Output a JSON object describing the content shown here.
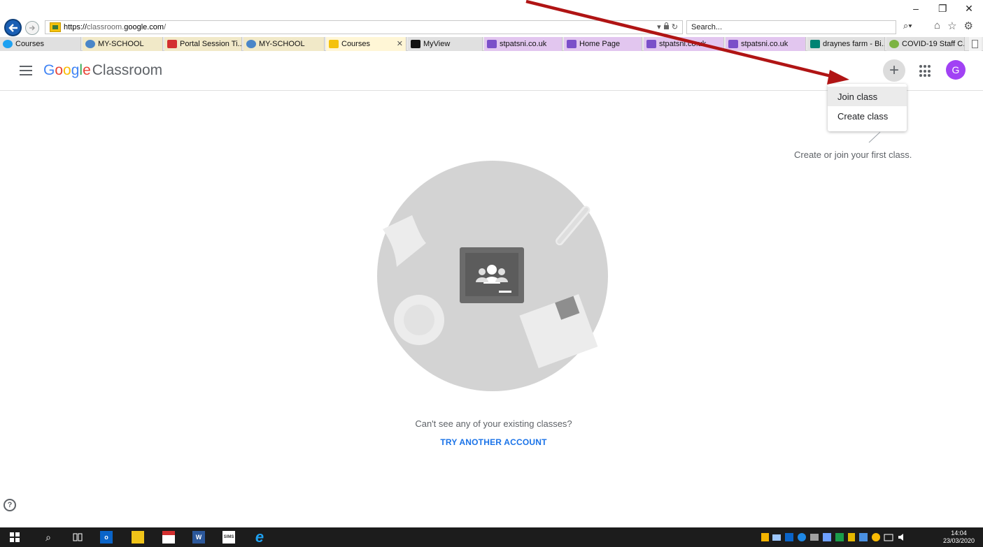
{
  "browser": {
    "url_scheme": "https://",
    "url_prefix": "classroom.",
    "url_host": "google.com",
    "url_suffix": "/",
    "search_placeholder": "Search...",
    "window_controls": [
      "–",
      "❐",
      "✕"
    ],
    "tabs": [
      {
        "label": "Courses",
        "icon": "ie-icon",
        "color": "#e0e0e0"
      },
      {
        "label": "MY-SCHOOL",
        "icon": "myschool-icon",
        "color": "#f1e9c8"
      },
      {
        "label": "Portal Session Ti...",
        "icon": "n-icon",
        "color": "#f1e9c8"
      },
      {
        "label": "MY-SCHOOL",
        "icon": "myschool-icon",
        "color": "#f1e9c8"
      },
      {
        "label": "Courses",
        "icon": "classroom-icon",
        "color": "#fff6d6",
        "active": true
      },
      {
        "label": "MyView",
        "icon": "myview-icon",
        "color": "#e0e0e0"
      },
      {
        "label": "stpatsni.co.uk",
        "icon": "w-icon",
        "color": "#e2c6ef"
      },
      {
        "label": "Home Page",
        "icon": "w-icon",
        "color": "#e2c6ef"
      },
      {
        "label": "stpatsni.co.uk",
        "icon": "w-icon",
        "color": "#e2c6ef"
      },
      {
        "label": "stpatsni.co.uk",
        "icon": "w-icon",
        "color": "#e2c6ef"
      },
      {
        "label": "draynes farm - Bi...",
        "icon": "bing-icon",
        "color": "#e0e0e0"
      },
      {
        "label": "COVID-19 Staff C...",
        "icon": "covid-icon",
        "color": "#e0e0e0"
      }
    ]
  },
  "app": {
    "brand_letters": [
      "G",
      "o",
      "o",
      "g",
      "l",
      "e"
    ],
    "brand_rest": "Classroom",
    "plus_label": "+",
    "avatar_letter": "G",
    "menu": {
      "join": "Join class",
      "create": "Create class"
    },
    "hint": "Create or join your first class.",
    "no_classes": "Can't see any of your existing classes?",
    "try_another": "TRY ANOTHER ACCOUNT",
    "help": "?"
  },
  "taskbar": {
    "time": "14:04",
    "date": "23/03/2020"
  },
  "colors": {
    "accent_blue": "#1a73e8",
    "avatar_purple": "#a142f4",
    "arrow_red": "#b01414"
  }
}
